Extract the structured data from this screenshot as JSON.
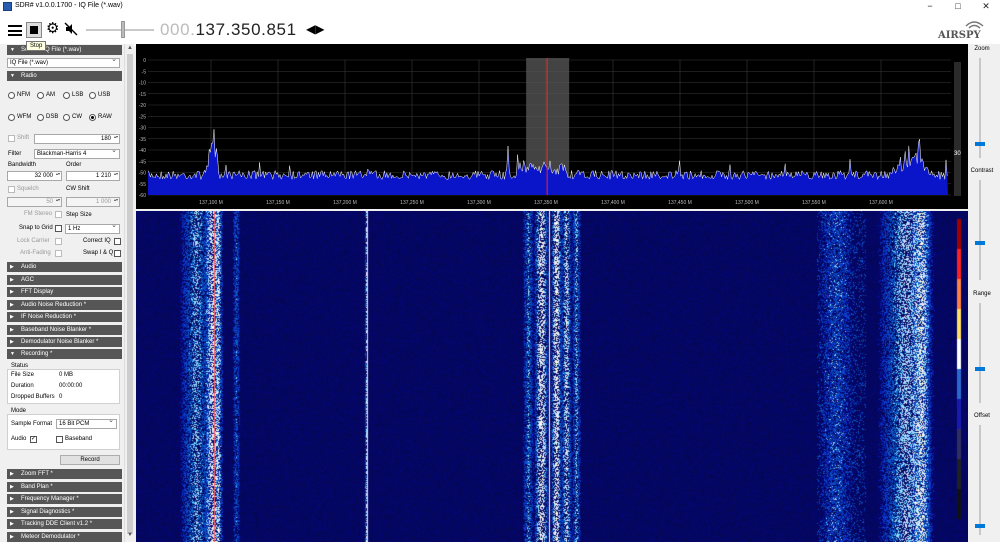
{
  "window": {
    "title": "SDR# v1.0.0.1700 - IQ File (*.wav)",
    "controls": {
      "minimize": "−",
      "maximize": "□",
      "close": "✕"
    }
  },
  "toolbar": {
    "frequency_dim": "000.",
    "frequency_main": "137.350.851",
    "arrows": "◀▶",
    "stop_tooltip": "Stop",
    "logo_text": "AIRSPY",
    "volume_level": 0.55
  },
  "source": {
    "header": "Source: IQ File (*.wav)",
    "selected": "IQ File (*.wav)"
  },
  "radio": {
    "header": "Radio",
    "modes": [
      "NFM",
      "AM",
      "LSB",
      "USB",
      "WFM",
      "DSB",
      "CW",
      "RAW"
    ],
    "selected_mode": "RAW",
    "shift_label": "Shift",
    "shift_value": "180",
    "filter_label": "Filter",
    "filter_value": "Blackman-Harris 4",
    "bandwidth_label": "Bandwidth",
    "bandwidth_value": "32 000",
    "order_label": "Order",
    "order_value": "1 210",
    "squelch_label": "Squelch",
    "squelch_value": "50",
    "cw_shift_label": "CW Shift",
    "cw_shift_value": "1 000",
    "fm_stereo_label": "FM Stereo",
    "step_size_label": "Step Size",
    "snap_label": "Snap to Grid",
    "step_value": "1 Hz",
    "lock_carrier_label": "Lock Carrier",
    "correct_iq_label": "Correct IQ",
    "anti_fading_label": "Anti-Fading",
    "swap_iq_label": "Swap I & Q"
  },
  "sections_collapsed_top": [
    "Audio",
    "AGC",
    "FFT Display",
    "Audio Noise Reduction *",
    "IF Noise Reduction *",
    "Baseband Noise Blanker *",
    "Demodulator Noise Blanker *"
  ],
  "recording": {
    "header": "Recording *",
    "status_title": "Status",
    "file_size_label": "File Size",
    "file_size_value": "0 MB",
    "duration_label": "Duration",
    "duration_value": "00:00:00",
    "dropped_label": "Dropped Buffers",
    "dropped_value": "0",
    "mode_title": "Mode",
    "sample_format_label": "Sample Format",
    "sample_format_value": "16 Bit PCM",
    "audio_label": "Audio",
    "baseband_label": "Baseband",
    "record_button": "Record"
  },
  "sections_collapsed_bottom": [
    "Zoom FFT *",
    "Band Plan *",
    "Frequency Manager *",
    "Signal Diagnostics *",
    "Tracking DDE Client v1.2 *",
    "Meteor Demodulator *"
  ],
  "spectrum": {
    "db_ticks": [
      "0",
      "-5",
      "-10",
      "-15",
      "-20",
      "-25",
      "-30",
      "-35",
      "-40",
      "-45",
      "-50",
      "-55",
      "-60"
    ],
    "freq_ticks": [
      "137,100 M",
      "137,150 M",
      "137,200 M",
      "137,250 M",
      "137,300 M",
      "137,350 M",
      "137,400 M",
      "137,450 M",
      "137,500 M",
      "137,550 M",
      "137,600 M"
    ],
    "level_readout": "30",
    "colors": {
      "fill": "#0a14c8",
      "trace": "#ffffff",
      "center_line": "#ff2020",
      "passband": "#5a5a5a"
    }
  },
  "right_panel": {
    "zoom_label": "Zoom",
    "contrast_label": "Contrast",
    "range_label": "Range",
    "offset_label": "Offset"
  }
}
